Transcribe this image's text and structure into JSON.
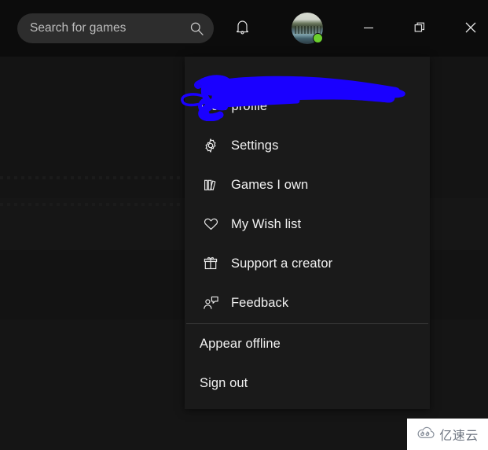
{
  "window": {
    "background_color": "#121212",
    "titlebar_color": "#0c0c0c"
  },
  "search": {
    "placeholder": "Search for games",
    "value": "",
    "icon": "search-icon"
  },
  "titlebar": {
    "notification_icon": "bell-icon",
    "avatar_icon": "avatar",
    "online_status": "online",
    "online_color": "#6ccf2e",
    "minimize_label": "—",
    "maximize_label": "restore-icon",
    "close_label": "✕"
  },
  "account_menu": {
    "background_color": "#1a1a1a",
    "redaction": {
      "type": "scribble",
      "color": "#1a00ff",
      "covers": "account-username"
    },
    "items": [
      {
        "label": "View profile",
        "icon": "none"
      },
      {
        "label": "Settings",
        "icon": "gear-icon"
      },
      {
        "label": "Games I own",
        "icon": "books-icon"
      },
      {
        "label": "My Wish list",
        "icon": "heart-icon"
      },
      {
        "label": "Support a creator",
        "icon": "gift-icon"
      },
      {
        "label": "Feedback",
        "icon": "feedback-icon"
      },
      {
        "label": "Appear offline",
        "icon": "none"
      },
      {
        "label": "Sign out",
        "icon": "none"
      }
    ]
  },
  "watermark": {
    "text": "亿速云",
    "icon": "cloud-logo",
    "color": "#6d7480",
    "background": "#ffffff"
  }
}
